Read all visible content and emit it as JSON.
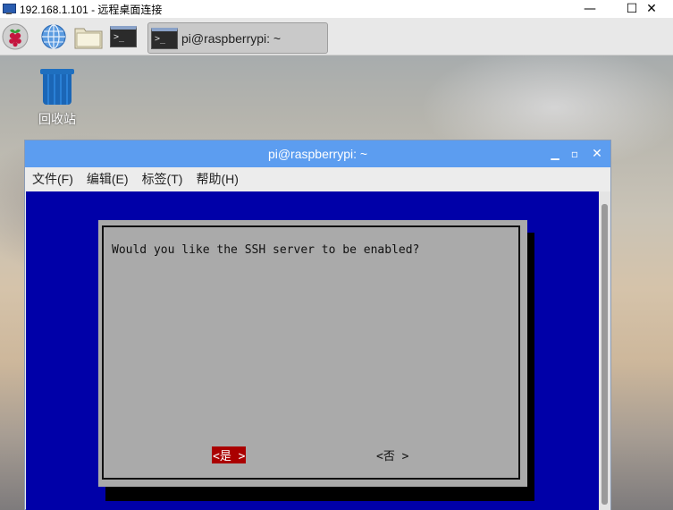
{
  "rdp": {
    "title": "192.168.1.101 - 远程桌面连接",
    "min_glyph": "—",
    "max_glyph": "☐",
    "close_glyph": "✕"
  },
  "taskbar": {
    "active_task_label": "pi@raspberrypi: ~"
  },
  "desktop": {
    "trash_label": "回收站"
  },
  "terminal": {
    "title": "pi@raspberrypi: ~",
    "menu": [
      "文件(F)",
      "编辑(E)",
      "标签(T)",
      "帮助(H)"
    ],
    "ctl_min": "▁",
    "ctl_max": "▫",
    "ctl_close": "✕",
    "icon_text": ">_"
  },
  "dialog": {
    "question": "Would you like the SSH server to be enabled?",
    "yes_label": "<是 >",
    "no_label": "<否 >"
  },
  "colors": {
    "terminal_bg": "#0000a8",
    "dialog_bg": "#aaaaaa",
    "titlebar": "#5c9df0",
    "selected_button": "#aa0000"
  }
}
